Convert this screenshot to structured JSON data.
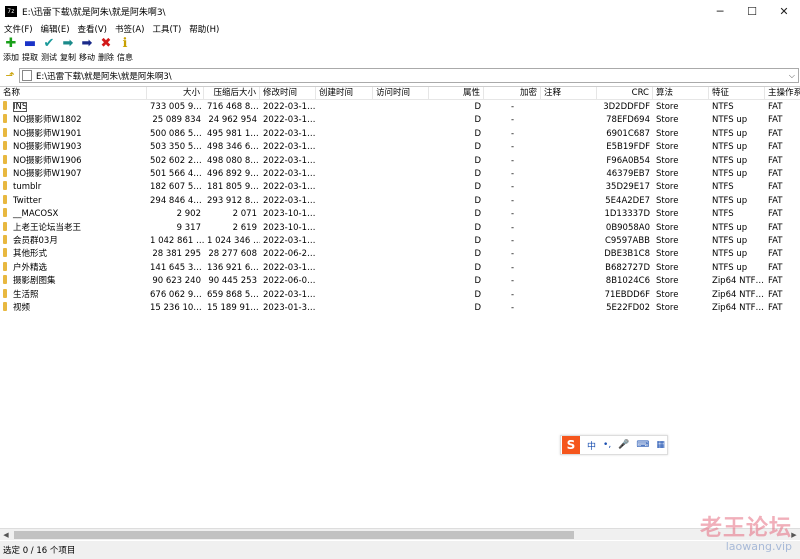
{
  "window": {
    "icon_text": "7z",
    "title": "E:\\迅雷下载\\就是阿朱\\就是阿朱啊3\\",
    "minimize_glyph": "─",
    "maximize_glyph": "☐",
    "close_glyph": "✕"
  },
  "menu": [
    "文件(F)",
    "编辑(E)",
    "查看(V)",
    "书签(A)",
    "工具(T)",
    "帮助(H)"
  ],
  "toolbar": [
    {
      "label": "添加",
      "icon": "add-icon",
      "glyph": "✚",
      "color": "#1aa01a"
    },
    {
      "label": "提取",
      "icon": "extract-icon",
      "glyph": "▬",
      "color": "#1a33c8"
    },
    {
      "label": "测试",
      "icon": "test-icon",
      "glyph": "✔",
      "color": "#1a9a9a"
    },
    {
      "label": "复制",
      "icon": "copy-icon",
      "glyph": "➡",
      "color": "#1a8a8a"
    },
    {
      "label": "移动",
      "icon": "move-icon",
      "glyph": "➡",
      "color": "#1a2a8a"
    },
    {
      "label": "删除",
      "icon": "delete-icon",
      "glyph": "✖",
      "color": "#d21a1a"
    },
    {
      "label": "信息",
      "icon": "info-icon",
      "glyph": "ℹ",
      "color": "#c8a000"
    }
  ],
  "address": {
    "path": "E:\\迅雷下载\\就是阿朱\\就是阿朱啊3\\",
    "dropdown_glyph": "⌵"
  },
  "columns": [
    {
      "label": "名称",
      "align": "l"
    },
    {
      "label": "大小",
      "align": "r"
    },
    {
      "label": "压缩后大小",
      "align": "r"
    },
    {
      "label": "修改时间",
      "align": "l"
    },
    {
      "label": "创建时间",
      "align": "l"
    },
    {
      "label": "访问时间",
      "align": "l"
    },
    {
      "label": "属性",
      "align": "r"
    },
    {
      "label": "加密",
      "align": "r"
    },
    {
      "label": "注释",
      "align": "l"
    },
    {
      "label": "CRC",
      "align": "r"
    },
    {
      "label": "算法",
      "align": "l"
    },
    {
      "label": "特征",
      "align": "l"
    },
    {
      "label": "主操作系",
      "align": "l"
    }
  ],
  "rows": [
    {
      "name": "INS",
      "size": "733 005 9…",
      "packed": "716 468 8…",
      "modified": "2022-03-1…",
      "created": "",
      "accessed": "",
      "attr": "D",
      "encrypted": "-",
      "comment": "",
      "crc": "3D2DDFDF",
      "method": "Store",
      "characteristics": "NTFS",
      "host_os": "FAT"
    },
    {
      "name": "NO摄影师W1802",
      "size": "25 089 834",
      "packed": "24 962 954",
      "modified": "2022-03-1…",
      "created": "",
      "accessed": "",
      "attr": "D",
      "encrypted": "-",
      "comment": "",
      "crc": "78EFD694",
      "method": "Store",
      "characteristics": "NTFS up",
      "host_os": "FAT"
    },
    {
      "name": "NO摄影师W1901",
      "size": "500 086 5…",
      "packed": "495 981 1…",
      "modified": "2022-03-1…",
      "created": "",
      "accessed": "",
      "attr": "D",
      "encrypted": "-",
      "comment": "",
      "crc": "6901C687",
      "method": "Store",
      "characteristics": "NTFS up",
      "host_os": "FAT"
    },
    {
      "name": "NO摄影师W1903",
      "size": "503 350 5…",
      "packed": "498 346 6…",
      "modified": "2022-03-1…",
      "created": "",
      "accessed": "",
      "attr": "D",
      "encrypted": "-",
      "comment": "",
      "crc": "E5B19FDF",
      "method": "Store",
      "characteristics": "NTFS up",
      "host_os": "FAT"
    },
    {
      "name": "NO摄影师W1906",
      "size": "502 602 2…",
      "packed": "498 080 8…",
      "modified": "2022-03-1…",
      "created": "",
      "accessed": "",
      "attr": "D",
      "encrypted": "-",
      "comment": "",
      "crc": "F96A0B54",
      "method": "Store",
      "characteristics": "NTFS up",
      "host_os": "FAT"
    },
    {
      "name": "NO摄影师W1907",
      "size": "501 566 4…",
      "packed": "496 892 9…",
      "modified": "2022-03-1…",
      "created": "",
      "accessed": "",
      "attr": "D",
      "encrypted": "-",
      "comment": "",
      "crc": "46379EB7",
      "method": "Store",
      "characteristics": "NTFS up",
      "host_os": "FAT"
    },
    {
      "name": "tumblr",
      "size": "182 607 5…",
      "packed": "181 805 9…",
      "modified": "2022-03-1…",
      "created": "",
      "accessed": "",
      "attr": "D",
      "encrypted": "-",
      "comment": "",
      "crc": "35D29E17",
      "method": "Store",
      "characteristics": "NTFS",
      "host_os": "FAT"
    },
    {
      "name": "Twitter",
      "size": "294 846 4…",
      "packed": "293 912 8…",
      "modified": "2022-03-1…",
      "created": "",
      "accessed": "",
      "attr": "D",
      "encrypted": "-",
      "comment": "",
      "crc": "5E4A2DE7",
      "method": "Store",
      "characteristics": "NTFS up",
      "host_os": "FAT"
    },
    {
      "name": "__MACOSX",
      "size": "2 902",
      "packed": "2 071",
      "modified": "2023-10-1…",
      "created": "",
      "accessed": "",
      "attr": "D",
      "encrypted": "-",
      "comment": "",
      "crc": "1D13337D",
      "method": "Store",
      "characteristics": "NTFS",
      "host_os": "FAT"
    },
    {
      "name": "上老王论坛当老王",
      "size": "9 317",
      "packed": "2 619",
      "modified": "2023-10-1…",
      "created": "",
      "accessed": "",
      "attr": "D",
      "encrypted": "-",
      "comment": "",
      "crc": "0B9058A0",
      "method": "Store",
      "characteristics": "NTFS up",
      "host_os": "FAT"
    },
    {
      "name": "会员群03月",
      "size": "1 042 861 …",
      "packed": "1 024 346 …",
      "modified": "2022-03-1…",
      "created": "",
      "accessed": "",
      "attr": "D",
      "encrypted": "-",
      "comment": "",
      "crc": "C9597ABB",
      "method": "Store",
      "characteristics": "NTFS up",
      "host_os": "FAT"
    },
    {
      "name": "其他形式",
      "size": "28 381 295",
      "packed": "28 277 608",
      "modified": "2022-06-2…",
      "created": "",
      "accessed": "",
      "attr": "D",
      "encrypted": "-",
      "comment": "",
      "crc": "DBE3B1C8",
      "method": "Store",
      "characteristics": "NTFS up",
      "host_os": "FAT"
    },
    {
      "name": "户外精选",
      "size": "141 645 3…",
      "packed": "136 921 6…",
      "modified": "2022-03-1…",
      "created": "",
      "accessed": "",
      "attr": "D",
      "encrypted": "-",
      "comment": "",
      "crc": "B682727D",
      "method": "Store",
      "characteristics": "NTFS up",
      "host_os": "FAT"
    },
    {
      "name": "摄影剧图集",
      "size": "90 623 240",
      "packed": "90 445 253",
      "modified": "2022-06-0…",
      "created": "",
      "accessed": "",
      "attr": "D",
      "encrypted": "-",
      "comment": "",
      "crc": "8B1024C6",
      "method": "Store",
      "characteristics": "Zip64 NTF…",
      "host_os": "FAT"
    },
    {
      "name": "生活照",
      "size": "676 062 9…",
      "packed": "659 868 5…",
      "modified": "2022-03-1…",
      "created": "",
      "accessed": "",
      "attr": "D",
      "encrypted": "-",
      "comment": "",
      "crc": "71EBDD6F",
      "method": "Store",
      "characteristics": "Zip64 NTF…",
      "host_os": "FAT"
    },
    {
      "name": "视频",
      "size": "15 236 10…",
      "packed": "15 189 91…",
      "modified": "2023-01-3…",
      "created": "",
      "accessed": "",
      "attr": "D",
      "encrypted": "-",
      "comment": "",
      "crc": "5E22FD02",
      "method": "Store",
      "characteristics": "Zip64 NTF…",
      "host_os": "FAT"
    }
  ],
  "status": {
    "text": "选定 0 / 16 个项目"
  },
  "ime": {
    "logo": "S",
    "lang": "中",
    "punct": "•,",
    "mic": "🎤",
    "keyboard": "⌨",
    "grid": "▦"
  },
  "watermark": {
    "main": "老王论坛",
    "sub": "laowang.vip"
  },
  "colors": {
    "folder": "#e8b840",
    "ime_brand": "#f5561d"
  }
}
